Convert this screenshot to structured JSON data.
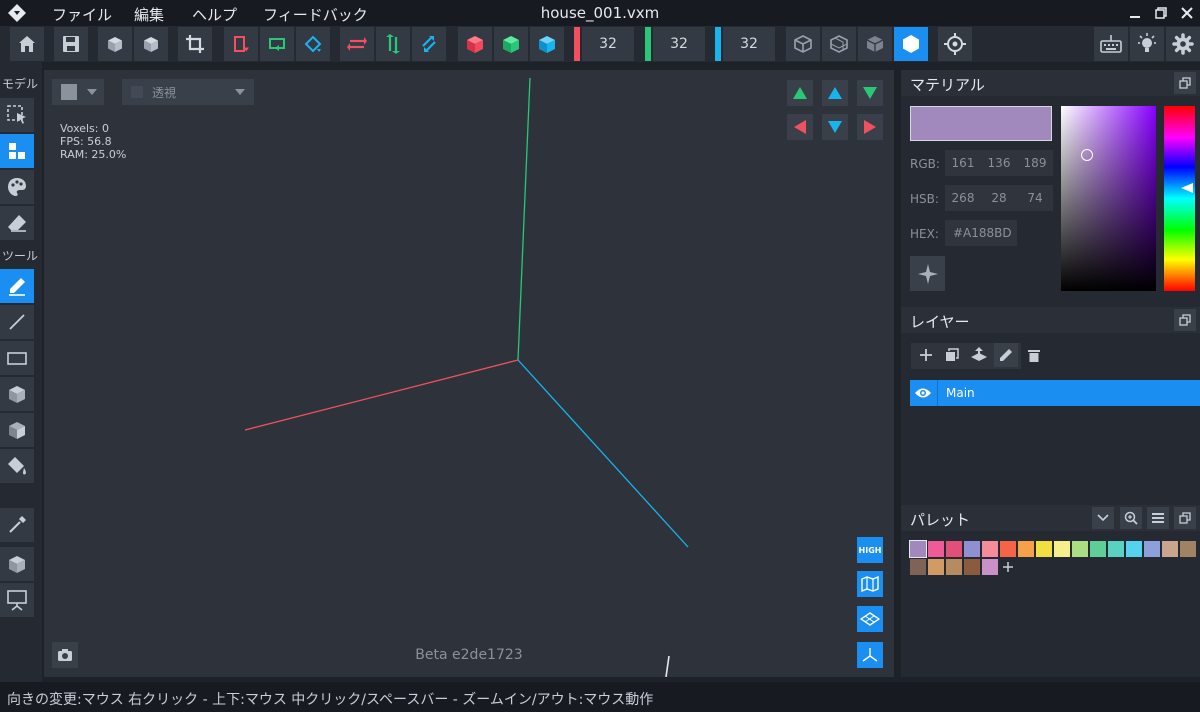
{
  "app": {
    "filename": "house_001.vxm"
  },
  "menu": {
    "items": [
      "ファイル",
      "編集",
      "ヘルプ",
      "フィードバック"
    ]
  },
  "toolbar": {
    "dimensions": {
      "x": "32",
      "y": "32",
      "z": "32"
    },
    "colors": {
      "x": "#f05060",
      "y": "#28c878",
      "z": "#18b4ee"
    }
  },
  "lefttools": {
    "section_model": "モデル",
    "section_tools": "ツール"
  },
  "viewport": {
    "projection": "透視",
    "stats": {
      "voxels": "Voxels: 0",
      "fps": "FPS: 56.8",
      "ram": "RAM: 25.0%"
    },
    "quality_label": "HIGH",
    "version": "Beta e2de1723"
  },
  "panels": {
    "material": {
      "title": "マテリアル",
      "swatch_color": "#A188BD",
      "rgb_label": "RGB:",
      "rgb": [
        "161",
        "136",
        "189"
      ],
      "hsb_label": "HSB:",
      "hsb": [
        "268",
        "28",
        "74"
      ],
      "hex_label": "HEX:",
      "hex": "#A188BD"
    },
    "layers": {
      "title": "レイヤー",
      "items": [
        {
          "name": "Main",
          "visible": true,
          "selected": true
        }
      ]
    },
    "palette": {
      "title": "パレット",
      "colors": [
        "#a188bd",
        "#f05a96",
        "#e05078",
        "#8f8fd2",
        "#f58c9b",
        "#f56446",
        "#f5a04b",
        "#f0e140",
        "#f5f08c",
        "#aade82",
        "#5fcd96",
        "#5ad2c3",
        "#55d2f0",
        "#8ca0dc",
        "#c8a58c",
        "#a08264",
        "#7d6455",
        "#d29b64",
        "#b48c5f",
        "#8c5a3c",
        "#c891c8"
      ]
    }
  },
  "statusbar": {
    "text": "向きの変更:マウス 右クリック - 上下:マウス 中クリック/スペースバー - ズームイン/アウト:マウス動作"
  }
}
